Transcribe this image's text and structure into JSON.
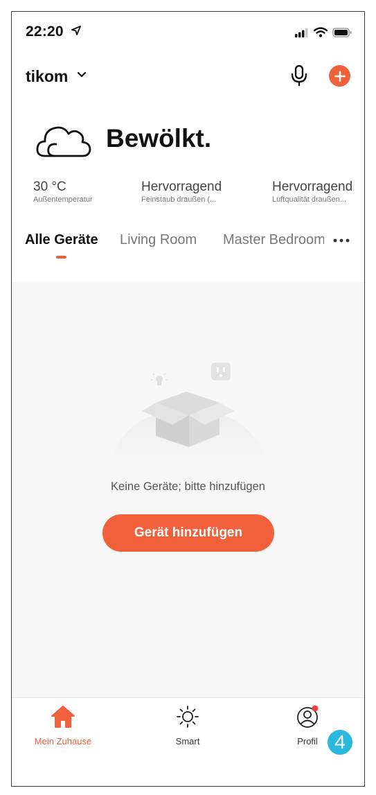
{
  "status_bar": {
    "time": "22:20"
  },
  "header": {
    "home_name": "tikom"
  },
  "weather": {
    "condition": "Bewölkt.",
    "stats": [
      {
        "value": "30 °C",
        "label": "Außentemperatur"
      },
      {
        "value": "Hervorragend",
        "label": "Feinstaub draußen (..."
      },
      {
        "value": "Hervorragend",
        "label": "Luftqualität draußen..."
      }
    ]
  },
  "tabs": [
    "Alle Geräte",
    "Living Room",
    "Master Bedroom"
  ],
  "empty_state": {
    "message": "Keine Geräte; bitte hinzufügen",
    "button_label": "Gerät hinzufügen"
  },
  "tabbar": {
    "items": [
      {
        "label": "Mein Zuhause",
        "icon": "home-icon"
      },
      {
        "label": "Smart",
        "icon": "sun-icon"
      },
      {
        "label": "Profil",
        "icon": "profile-icon"
      }
    ]
  },
  "overlay_badge": "4",
  "colors": {
    "accent": "#f0603b",
    "badge": "#29b8de"
  }
}
